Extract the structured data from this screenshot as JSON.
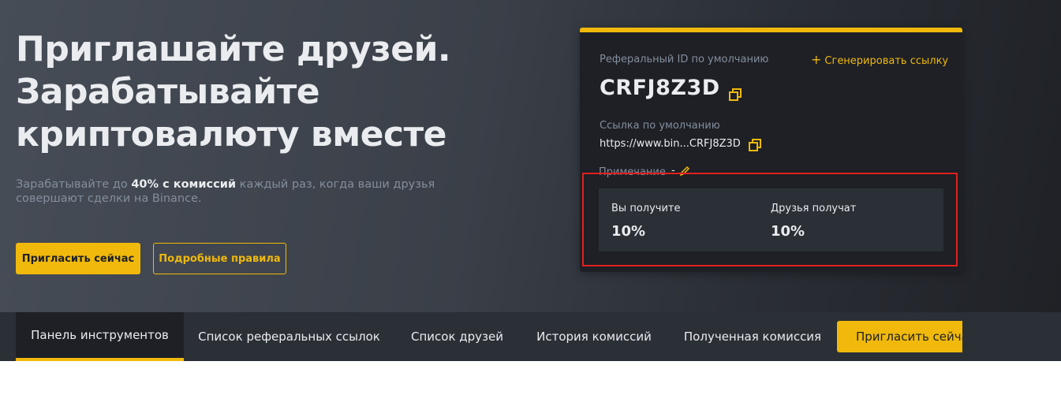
{
  "hero": {
    "headline_lines": [
      "Приглашайте друзей.",
      "Зарабатывайте",
      "криптовалюту вместе"
    ],
    "subtext_pre": "Зарабатывайте до ",
    "subtext_bold": "40% с комиссий",
    "subtext_post": " каждый раз, когда ваши друзья совершают сделки на Binance.",
    "invite_button": "Пригласить сейчас",
    "rules_button": "Подробные правила"
  },
  "card": {
    "ref_id_label": "Реферальный ID по умолчанию",
    "generate_link": "Сгенерировать ссылку",
    "generate_plus": "+",
    "ref_id": "CRFJ8Z3D",
    "link_label": "Ссылка по умолчанию",
    "link_value": "https://www.bin...CRFJ8Z3D",
    "note_label": "Примечание",
    "note_value": "-",
    "you_receive_label": "Вы получите",
    "you_receive_value": "10%",
    "friends_receive_label": "Друзья получат",
    "friends_receive_value": "10%"
  },
  "tabs": [
    {
      "label": "Панель инструментов",
      "active": true
    },
    {
      "label": "Список реферальных ссылок",
      "active": false
    },
    {
      "label": "Список друзей",
      "active": false
    },
    {
      "label": "История комиссий",
      "active": false
    },
    {
      "label": "Полученная комиссия",
      "active": false
    }
  ],
  "tab_invite_button": "Пригласить сейчас",
  "colors": {
    "accent": "#f0b90b",
    "card_bg": "#1e2026",
    "highlight": "#e02020"
  }
}
